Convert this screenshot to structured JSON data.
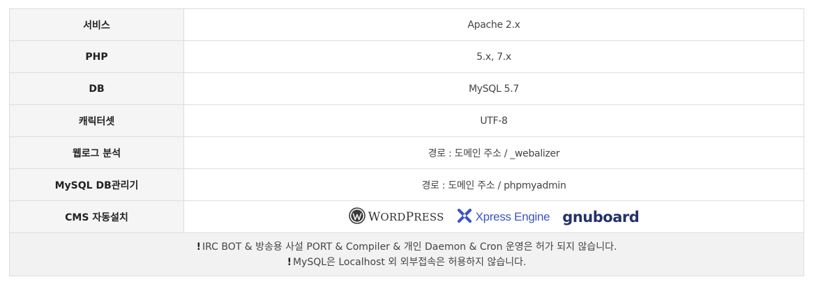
{
  "rows": [
    {
      "label": "서비스",
      "value": "Apache 2.x"
    },
    {
      "label": "PHP",
      "value": "5.x, 7.x"
    },
    {
      "label": "DB",
      "value": "MySQL 5.7"
    },
    {
      "label": "캐릭터셋",
      "value": "UTF-8"
    },
    {
      "label": "웹로그 분석",
      "value": "경로 : 도메인 주소 / _webalizer"
    },
    {
      "label": "MySQL DB관리기",
      "value": "경로 : 도메인 주소 / phpmyadmin"
    }
  ],
  "cms": {
    "label": "CMS 자동설치",
    "logos": [
      {
        "name": "WordPress",
        "text": "WordPress",
        "icon": "wordpress-icon"
      },
      {
        "name": "Xpress Engine",
        "text": "Xpress Engine",
        "icon": "xe-icon",
        "color": "#3b54c4"
      },
      {
        "name": "gnuboard",
        "text": "gnuboard",
        "color": "#24326b"
      }
    ]
  },
  "notes": {
    "mark": "!",
    "line1": "IRC BOT & 방송용 사설 PORT & Compiler & 개인 Daemon & Cron 운영은 허가 되지 않습니다.",
    "line2": "MySQL은 Localhost 외 외부접속은 허용하지 않습니다."
  }
}
